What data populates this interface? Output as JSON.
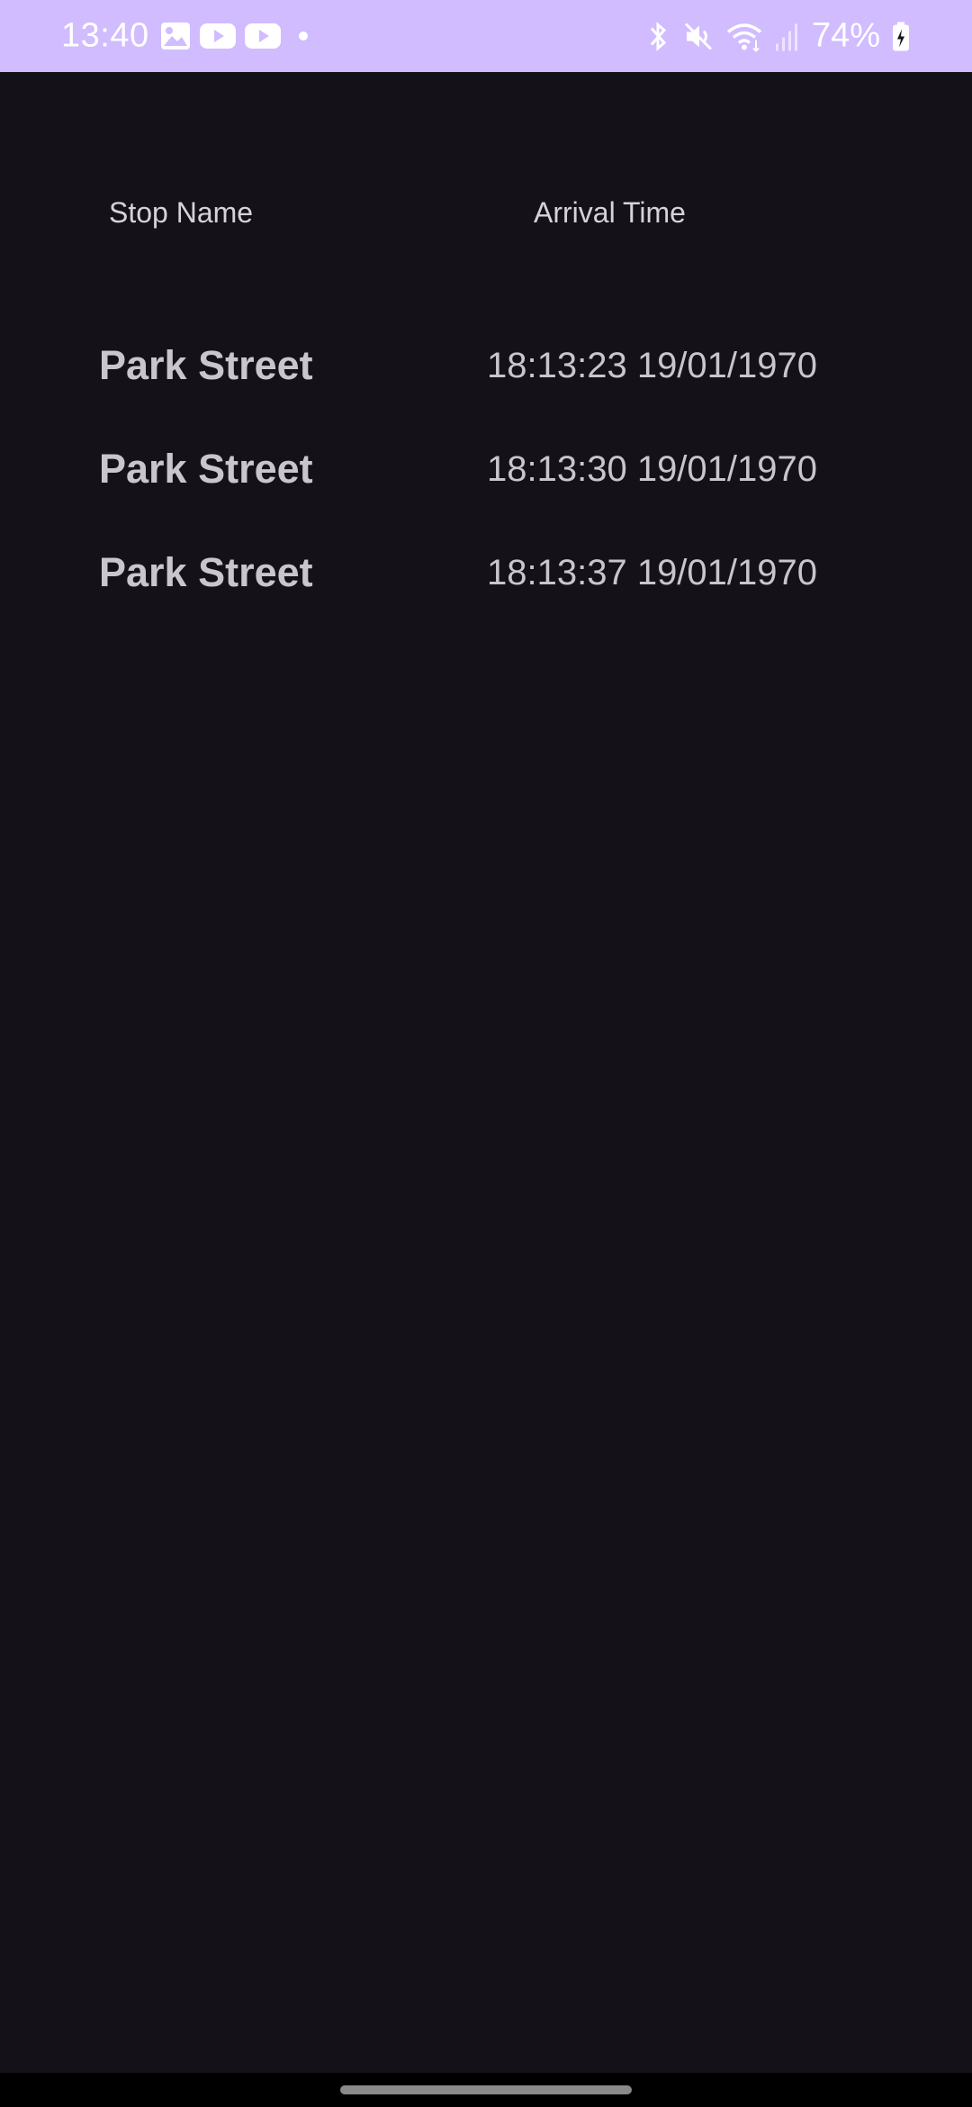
{
  "status_bar": {
    "time": "13:40",
    "battery": "74%",
    "left_icons": [
      "gallery-icon",
      "youtube-icon",
      "youtube-icon",
      "dot-icon"
    ],
    "right_icons": [
      "bluetooth-icon",
      "mute-icon",
      "wifi-icon",
      "signal-icon",
      "battery-charging-icon"
    ],
    "background_color": "#d0bcff"
  },
  "table": {
    "headers": {
      "stop_name": "Stop Name",
      "arrival_time": "Arrival Time"
    },
    "rows": [
      {
        "stop_name": "Park Street",
        "arrival_time": "18:13:23 19/01/1970"
      },
      {
        "stop_name": "Park Street",
        "arrival_time": "18:13:30 19/01/1970"
      },
      {
        "stop_name": "Park Street",
        "arrival_time": "18:13:37 19/01/1970"
      }
    ]
  },
  "colors": {
    "background": "#141218",
    "text": "#c9c5cd"
  }
}
